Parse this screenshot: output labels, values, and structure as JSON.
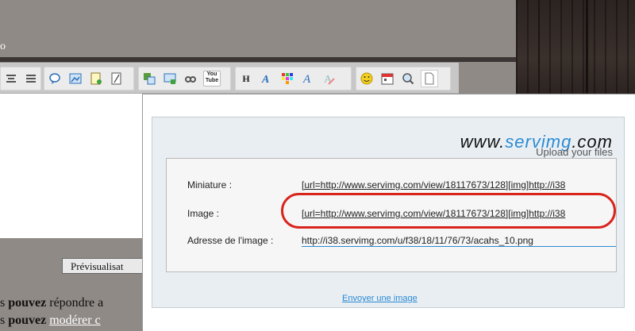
{
  "page": {
    "partial_bold": "o",
    "preview_button": "Prévisualisat",
    "line1_prefix": "s ",
    "line1_bold": "pouvez",
    "line1_text": " répondre a",
    "line2_prefix": "s ",
    "line2_bold": "pouvez",
    "line2_link": "modérer c"
  },
  "toolbar": {
    "icons": [
      "align-center-icon",
      "align-justify-icon",
      "comment-icon",
      "image-link-icon",
      "note-icon",
      "blank-page-icon",
      "hosted-image-icon",
      "screen-icon",
      "link-icon",
      "youtube-icon",
      "heading-icon",
      "font-style-icon",
      "color-grid-icon",
      "font-icon",
      "clear-format-icon",
      "smiley-icon",
      "calendar-icon",
      "search-icon",
      "document-icon"
    ],
    "youtube_text": "You Tube",
    "heading_text": "H"
  },
  "popup": {
    "logo_prefix": "www.",
    "logo_brand": "servimg",
    "logo_suffix": ".com",
    "tagline": "Upload your files",
    "rows": [
      {
        "label": "Miniature :",
        "value": "[url=http://www.servimg.com/view/18117673/128][img]http://i38"
      },
      {
        "label": "Image :",
        "value": "[url=http://www.servimg.com/view/18117673/128][img]http://i38"
      },
      {
        "label": "Adresse de l'image :",
        "value": "http://i38.servimg.com/u/f38/18/11/76/73/acahs_10.png"
      }
    ],
    "send_link": "Envoyer une image"
  },
  "colors": {
    "highlight": "#d9241c",
    "link": "#2a8bd3"
  }
}
